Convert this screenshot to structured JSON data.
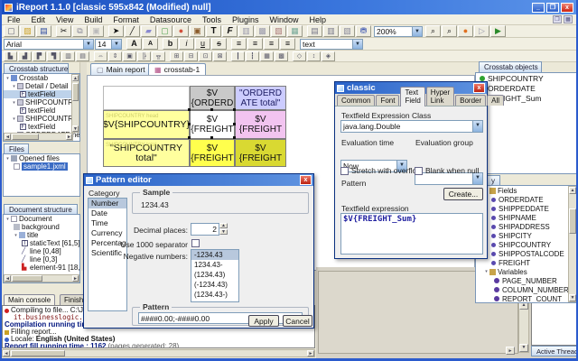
{
  "window": {
    "title": "iReport 1.1.0 [classic 595x842 (Modified) null]"
  },
  "menu": {
    "items": [
      "File",
      "Edit",
      "View",
      "Build",
      "Format",
      "Datasource",
      "Tools",
      "Plugins",
      "Window",
      "Help"
    ]
  },
  "toolbar1": {
    "zoom_value": "200%"
  },
  "toolbar2": {
    "font_name": "Arial",
    "font_size": "14",
    "style_combo": "text"
  },
  "glyphs": {
    "bold": "b",
    "italic": "i",
    "underline": "u",
    "strike": "s",
    "grow_font": "A",
    "shrink_font": "A",
    "static_text": "T",
    "text_field": "F",
    "up": "▲",
    "down": "▼",
    "left": "◄",
    "right": "►",
    "close": "x",
    "minimize": "_",
    "restore": "❐",
    "dropdown": "▼",
    "zoom_in": "⌕",
    "zoom_out": "⌕",
    "scissors": "✂",
    "pointer": "➤",
    "line": "╱",
    "align": "≡"
  },
  "doc_tabs": [
    {
      "label": "Main report"
    },
    {
      "label": "crosstab-1"
    }
  ],
  "left": {
    "crosstab_structure": {
      "title": "Crosstab structure",
      "items": [
        {
          "label": "Crosstab"
        },
        {
          "label": "Detail / Detail"
        },
        {
          "label": "textField"
        },
        {
          "label": "SHIPCOUNTRY head"
        },
        {
          "label": "textField"
        },
        {
          "label": "SHIPCOUNTRY total"
        },
        {
          "label": "textField"
        },
        {
          "label": "ORDERDATE head"
        }
      ]
    },
    "files": {
      "title": "Files",
      "root": "Opened files",
      "file": "sample1.jxml"
    },
    "document_structure": {
      "title": "Document structure",
      "items": [
        {
          "label": "Document"
        },
        {
          "label": "background"
        },
        {
          "label": "title"
        },
        {
          "label": "staticText [61,5]"
        },
        {
          "label": "line [0,48]"
        },
        {
          "label": "line [0,3]"
        },
        {
          "label": "element-91 [18,5"
        }
      ]
    }
  },
  "crosstab": {
    "col_header_1": {
      "l1": "$V",
      "l2": "{ORDERD",
      "style": "background:#c9c9c9"
    },
    "col_header_2": {
      "l1": "\"ORDERD",
      "l2": "ATE total\"",
      "style": "background:#ccccff;color:#1c1c60"
    },
    "row_header_1": {
      "text": "$V{SHIPCOUNTRY}",
      "faint": "SHIPCOUNTRY head",
      "style": "background:#ffff9e"
    },
    "row_header_2": {
      "text": "\"SHIPCOUNTRY total\"",
      "faint": "SHIPCOUNTRY total",
      "style": "background:#ffff9e"
    },
    "cell_detail": {
      "l1": "$V",
      "l2": "{FREIGHT",
      "style": "background:#ffffff"
    },
    "cell_coltotal": {
      "l1": "$V",
      "l2": "{FREIGHT",
      "style": "background:#f2c4f0"
    },
    "cell_rowtotal": {
      "l1": "$V",
      "l2": "{FREIGHT",
      "style": "background:#ffff4d"
    },
    "cell_grandtotal": {
      "l1": "$V",
      "l2": "{FREIGHT",
      "style": "background:#d9d932"
    }
  },
  "right": {
    "crosstab_objects": {
      "title": "Crosstab objects",
      "items": [
        "SHIPCOUNTRY",
        "ORDERDATE",
        "FREIGHT_Sum"
      ]
    },
    "library": {
      "tab_fragment": "y",
      "fields_node": "Fields",
      "fields": [
        "ORDERDATE",
        "SHIPPEDDATE",
        "SHIPNAME",
        "SHIPADDRESS",
        "SHIPCITY",
        "SHIPCOUNTRY",
        "SHIPPOSTALCODE",
        "FREIGHT"
      ],
      "variables_node": "Variables",
      "variables": [
        "PAGE_NUMBER",
        "COLUMN_NUMBER",
        "REPORT_COUNT"
      ]
    },
    "threads": {
      "tab": "Active Threads"
    }
  },
  "classic_dialog": {
    "title": "classic",
    "tabs": [
      "Common",
      "Font",
      "Text Field",
      "Hyper Link",
      "Border",
      "All"
    ],
    "active_tab": "Text Field",
    "expression_class_label": "Textfield Expression Class",
    "expression_class_value": "java.lang.Double",
    "evaluation_time_label": "Evaluation time",
    "evaluation_time_value": "Now",
    "evaluation_group_label": "Evaluation group",
    "stretch_label": "Stretch with overflow",
    "blank_label": "Blank when null",
    "pattern_label": "Pattern",
    "create_button": "Create...",
    "expression_label": "Textfield expression",
    "expression_value": "$V{FREIGHT_Sum}"
  },
  "pattern_dialog": {
    "title": "Pattern editor",
    "category_label": "Category",
    "categories": [
      "Number",
      "Date",
      "Time",
      "Currency",
      "Percentage",
      "Scientific"
    ],
    "selected_category": "Number",
    "sample_label": "Sample",
    "sample_value": "1234.43",
    "decimal_label": "Decimal places:",
    "decimal_value": "2",
    "separator_label": "Use 1000 separator",
    "negative_label": "Negative numbers:",
    "negative_options": [
      "-1234.43",
      "1234.43-",
      "(1234.43)",
      "(-1234.43)",
      "(1234.43-)"
    ],
    "pattern_label": "Pattern",
    "pattern_value": "####0.00;-####0.00",
    "apply_button": "Apply",
    "cancel_button": "Cancel"
  },
  "console": {
    "tabs": [
      "Main console",
      "Finished [samp"
    ],
    "lines": [
      {
        "text": "Compiling to file... C:\\Jaspe"
      },
      {
        "text": "it.businesslogic.irepor"
      },
      {
        "text": "Compilation running time : 19"
      },
      {
        "text": "Filling report..."
      },
      {
        "prefix": "Locale: ",
        "value": "English (United States)"
      },
      {
        "prefix": "Report fill running time : 1162 ",
        "suffix": "(pages generated: 28)"
      }
    ]
  },
  "colors": {
    "titlebar_blue": "#1a4fc0",
    "selection_blue": "#3a6bc4",
    "cell_yellow": "#ffff9e",
    "cell_lavender": "#ccccff",
    "cell_pink": "#f2c4f0",
    "cell_gray": "#c9c9c9"
  }
}
